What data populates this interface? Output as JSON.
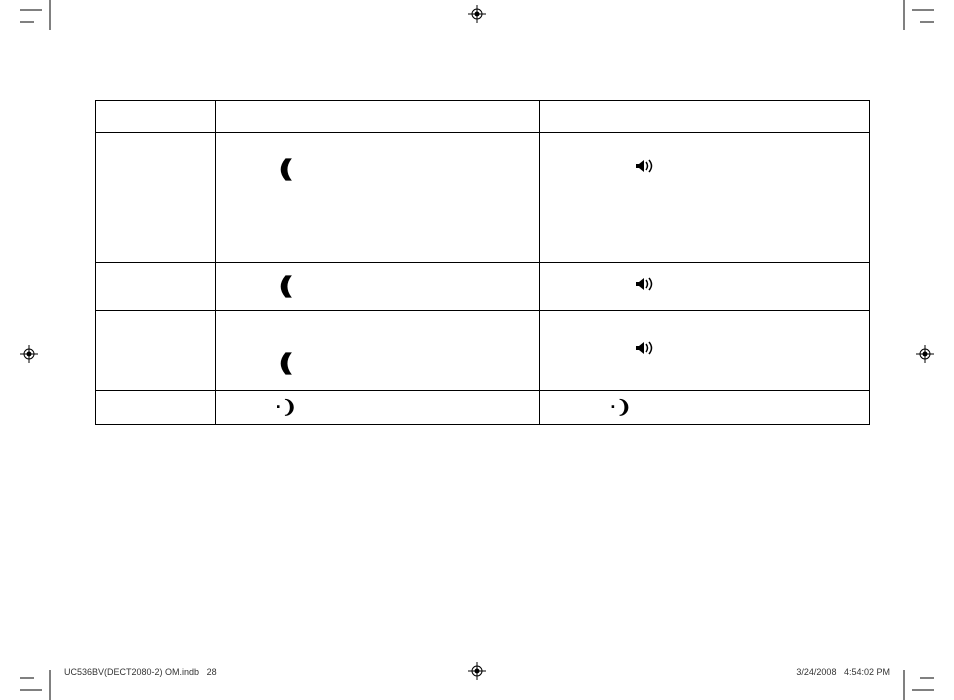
{
  "footer": {
    "doc_name": "UC536BV(DECT2080-2) OM.indb",
    "page_num": "28",
    "date": "3/24/2008",
    "time": "4:54:02 PM"
  },
  "table": {
    "header": {
      "c1": "",
      "c2": "",
      "c3": ""
    },
    "rows": [
      {
        "c1": "",
        "c2_icon": "talk-icon",
        "c3_icon": "speaker-icon"
      },
      {
        "c1": "",
        "c2_icon": "talk-icon",
        "c3_icon": "speaker-icon"
      },
      {
        "c1": "",
        "c2_icon": "talk-icon",
        "c3_icon": "speaker-icon"
      },
      {
        "c1": "",
        "c2_icon": "end-icon",
        "c3_icon": "end-icon"
      }
    ]
  },
  "icons": {
    "talk-icon": "talk/flash handset symbol",
    "speaker-icon": "speakerphone symbol",
    "end-icon": "end call symbol"
  }
}
